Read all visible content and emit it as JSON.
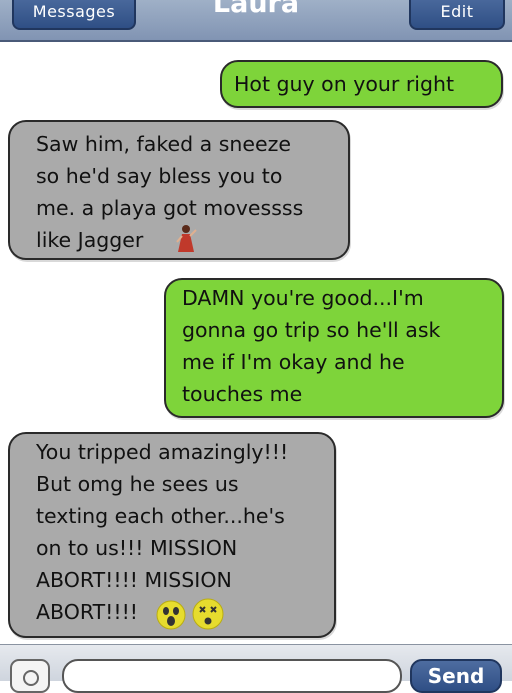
{
  "header": {
    "back_label": "Messages",
    "title": "Laura",
    "edit_label": "Edit"
  },
  "messages": [
    {
      "direction": "outgoing",
      "text": "Hot guy on your right"
    },
    {
      "direction": "incoming",
      "text": "Saw him, faked a sneeze\nso he'd say bless you to\nme. a playa got movessss\nlike Jagger",
      "emoji": [
        "dancer-icon"
      ]
    },
    {
      "direction": "outgoing",
      "text": "DAMN you're good...I'm\ngonna go trip so he'll ask\nme if I'm okay and he\ntouches me"
    },
    {
      "direction": "incoming",
      "text": "You tripped amazingly!!!\nBut omg he sees us\ntexting each other...he's\non to us!!! MISSION\nABORT!!!! MISSION\nABORT!!!!",
      "emoji": [
        "scream-face-icon",
        "dizzy-face-icon"
      ]
    }
  ],
  "input": {
    "send_label": "Send",
    "placeholder": ""
  },
  "colors": {
    "outgoing_bubble": "#7ed43a",
    "incoming_bubble": "#aaaaaa",
    "header": "#8194b3",
    "button": "#2f4f85"
  }
}
